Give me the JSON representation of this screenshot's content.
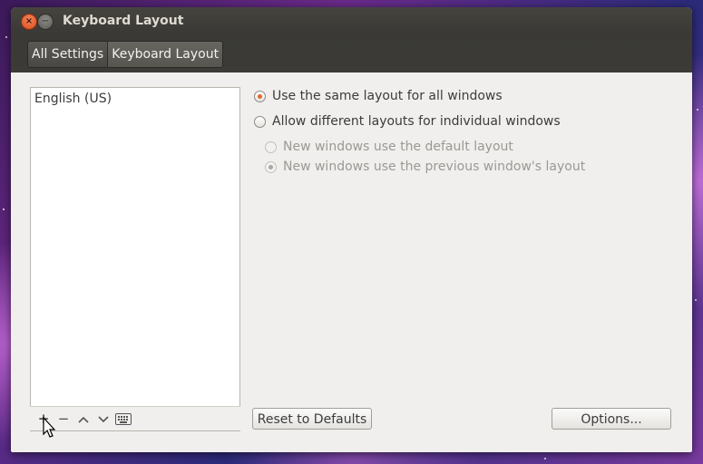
{
  "window": {
    "title": "Keyboard Layout",
    "close_glyph": "×",
    "minimize_glyph": "−"
  },
  "breadcrumb": {
    "items": [
      "All Settings",
      "Keyboard Layout"
    ]
  },
  "layouts": {
    "items": [
      "English (US)"
    ]
  },
  "layout_toolbar": {
    "add": "+",
    "remove": "−",
    "up": "︿",
    "down": "﹀"
  },
  "options": {
    "same_layout": "Use the same layout for all windows",
    "different_layouts": "Allow different layouts for individual windows",
    "default_layout": "New windows use the default layout",
    "previous_layout": "New windows use the previous window's layout"
  },
  "buttons": {
    "reset": "Reset to Defaults",
    "options": "Options..."
  },
  "colors": {
    "accent": "#e06b2d",
    "titlebar": "#3c3b37",
    "window_bg": "#f0efed"
  },
  "icons": [
    "close-icon",
    "minimize-icon",
    "add-icon",
    "remove-icon",
    "move-up-icon",
    "move-down-icon",
    "keyboard-icon",
    "mouse-cursor-icon"
  ]
}
